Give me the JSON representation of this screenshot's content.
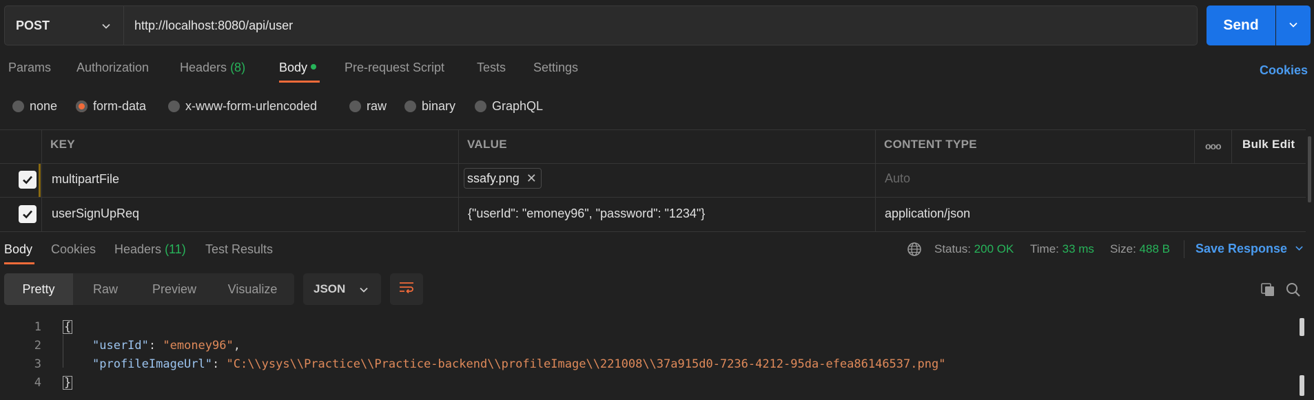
{
  "request": {
    "method": "POST",
    "url": "http://localhost:8080/api/user",
    "send_label": "Send"
  },
  "tabs": [
    {
      "label": "Params"
    },
    {
      "label": "Authorization"
    },
    {
      "label": "Headers",
      "count": "(8)"
    },
    {
      "label": "Body"
    },
    {
      "label": "Pre-request Script"
    },
    {
      "label": "Tests"
    },
    {
      "label": "Settings"
    }
  ],
  "cookies_label": "Cookies",
  "body_types": [
    {
      "label": "none",
      "selected": false
    },
    {
      "label": "form-data",
      "selected": true
    },
    {
      "label": "x-www-form-urlencoded",
      "selected": false
    },
    {
      "label": "raw",
      "selected": false
    },
    {
      "label": "binary",
      "selected": false
    },
    {
      "label": "GraphQL",
      "selected": false
    }
  ],
  "table": {
    "headers": {
      "key": "KEY",
      "value": "VALUE",
      "content_type": "CONTENT TYPE",
      "more": "ooo",
      "bulk_edit": "Bulk Edit"
    },
    "rows": [
      {
        "key": "multipartFile",
        "file": "ssafy.png",
        "content_type_placeholder": "Auto"
      },
      {
        "key": "userSignUpReq",
        "value": "{\"userId\": \"emoney96\", \"password\": \"1234\"}",
        "content_type": "application/json"
      }
    ]
  },
  "response": {
    "tabs": [
      {
        "label": "Body"
      },
      {
        "label": "Cookies"
      },
      {
        "label": "Headers",
        "count": "(11)"
      },
      {
        "label": "Test Results"
      }
    ],
    "status_label": "Status:",
    "status_value": "200 OK",
    "time_label": "Time:",
    "time_value": "33 ms",
    "size_label": "Size:",
    "size_value": "488 B",
    "save_label": "Save Response",
    "view_modes": [
      "Pretty",
      "Raw",
      "Preview",
      "Visualize"
    ],
    "format": "JSON",
    "code": {
      "line_numbers": [
        "1",
        "2",
        "3",
        "4"
      ],
      "open": "{",
      "close": "}",
      "k1": "\"userId\"",
      "v1": "\"emoney96\"",
      "k2": "\"profileImageUrl\"",
      "v2": "\"C:\\\\ysys\\\\Practice\\\\Practice-backend\\\\profileImage\\\\221008\\\\37a915d0-7236-4212-95da-efea86146537.png\""
    }
  },
  "colors": {
    "accent": "#f26b3a",
    "primary": "#1a73e8",
    "success": "#27b45a",
    "link": "#4a9bf0"
  }
}
